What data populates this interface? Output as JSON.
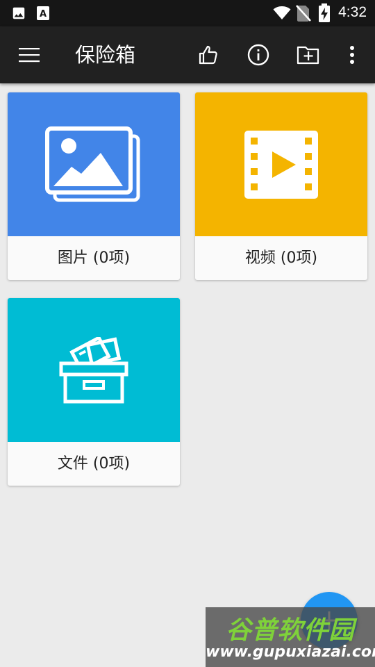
{
  "status_bar": {
    "time": "4:32",
    "icons": [
      "image-notification-icon",
      "a-notification-icon",
      "wifi-icon",
      "no-sim-icon",
      "battery-charging-icon"
    ]
  },
  "app_bar": {
    "title": "保险箱",
    "actions": [
      "menu-icon",
      "thumbs-up-icon",
      "info-icon",
      "new-folder-icon",
      "more-vert-icon"
    ],
    "color": "#212121"
  },
  "folders": [
    {
      "label": "图片 (0项)",
      "icon": "images-icon",
      "color": "#4285e8"
    },
    {
      "label": "视频 (0项)",
      "icon": "video-film-icon",
      "color": "#f4b400"
    },
    {
      "label": "文件 (0项)",
      "icon": "file-box-icon",
      "color": "#00bcd4"
    }
  ],
  "fab": {
    "color": "#2196f3"
  },
  "watermark": {
    "title": "谷普软件园",
    "url": "www.gupuxiazai.com"
  }
}
